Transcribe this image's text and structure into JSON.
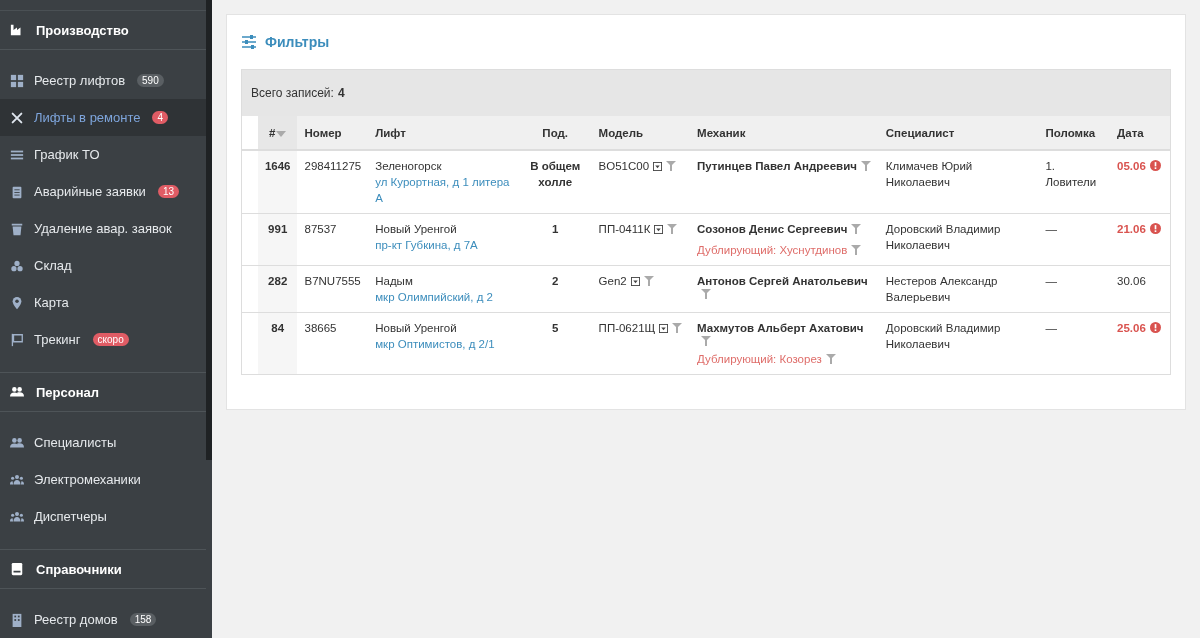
{
  "sidebar": {
    "sections": [
      {
        "title": "Производство",
        "items": [
          {
            "label": "Реестр лифтов",
            "selected": false,
            "badge": {
              "text": "590",
              "color": "#5a5f63"
            }
          },
          {
            "label": "Лифты в ремонте",
            "selected": true,
            "badge": {
              "text": "4",
              "color": "#e05c65"
            }
          },
          {
            "label": "График ТО",
            "selected": false
          },
          {
            "label": "Аварийные заявки",
            "selected": false,
            "badge": {
              "text": "13",
              "color": "#e05c65"
            }
          },
          {
            "label": "Удаление авар. заявок",
            "selected": false
          },
          {
            "label": "Склад",
            "selected": false
          },
          {
            "label": "Карта",
            "selected": false
          },
          {
            "label": "Трекинг",
            "selected": false,
            "badge": {
              "text": "скоро",
              "color": "#e05c65"
            }
          }
        ]
      },
      {
        "title": "Персонал",
        "items": [
          {
            "label": "Специалисты",
            "selected": false
          },
          {
            "label": "Электромеханики",
            "selected": false
          },
          {
            "label": "Диспетчеры",
            "selected": false
          }
        ]
      },
      {
        "title": "Справочники",
        "items": [
          {
            "label": "Реестр домов",
            "selected": false,
            "badge": {
              "text": "158",
              "color": "#5a5f63"
            }
          }
        ]
      }
    ]
  },
  "filters": {
    "title": "Фильтры"
  },
  "table": {
    "total_label": "Всего записей:",
    "total": "4",
    "columns": [
      "#",
      "Номер",
      "Лифт",
      "Под.",
      "Модель",
      "Механик",
      "Специалист",
      "Поломка",
      "Дата"
    ],
    "rows": [
      {
        "id": "1646",
        "number": "298411275",
        "city": "Зеленогорск",
        "address": "ул Курортная, д 1 литера А",
        "entrance": "В общем холле",
        "model": "BO51C00",
        "mechanic": "Путинцев Павел Андреевич",
        "duplicate": "",
        "specialist": "Климачев Юрий Николаевич",
        "breakdown": "1. Ловители",
        "date": "05.06",
        "overdue": true
      },
      {
        "id": "991",
        "number": "87537",
        "city": "Новый Уренгой",
        "address": "пр-кт Губкина, д 7А",
        "entrance": "1",
        "model": "ПП-0411К",
        "mechanic": "Созонов Денис Сергеевич",
        "duplicate": "Дублирующий: Хуснутдинов",
        "specialist": "Доровский Владимир Николаевич",
        "breakdown": "—",
        "date": "21.06",
        "overdue": true
      },
      {
        "id": "282",
        "number": "B7NU7555",
        "city": "Надым",
        "address": "мкр Олимпийский, д 2",
        "entrance": "2",
        "model": "Gen2",
        "mechanic": "Антонов Сергей Анатольевич",
        "duplicate": "",
        "specialist": "Нестеров Александр Валерьевич",
        "breakdown": "—",
        "date": "30.06",
        "overdue": false
      },
      {
        "id": "84",
        "number": "38665",
        "city": "Новый Уренгой",
        "address": "мкр Оптимистов, д 2/1",
        "entrance": "5",
        "model": "ПП-0621Щ",
        "mechanic": "Махмутов Альберт Ахатович",
        "duplicate": "Дублирующий: Козорез",
        "specialist": "Доровский Владимир Николаевич",
        "breakdown": "—",
        "date": "25.06",
        "overdue": true
      }
    ]
  }
}
